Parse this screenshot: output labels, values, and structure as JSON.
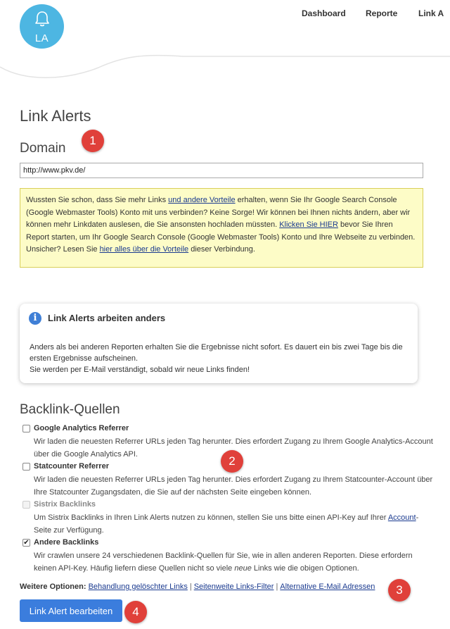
{
  "logo": {
    "text": "LA"
  },
  "nav": {
    "items": [
      "Dashboard",
      "Reporte",
      "Link A"
    ]
  },
  "page": {
    "title": "Link Alerts"
  },
  "domain": {
    "heading": "Domain",
    "value": "http://www.pkv.de/"
  },
  "hint": {
    "p1": "Wussten Sie schon, dass Sie mehr Links ",
    "link1": "und andere Vorteile",
    "p2": " erhalten, wenn Sie Ihr Google Search Console (Google Webmaster Tools) Konto mit uns verbinden? Keine Sorge! Wir können bei Ihnen nichts ändern, aber wir können mehr Linkdaten auslesen, die Sie ansonsten hochladen müssten. ",
    "link2": "Klicken Sie HIER",
    "p3": " bevor Sie Ihren Report starten, um Ihr Google Search Console (Google Webmaster Tools) Konto und Ihre Webseite zu verbinden. Unsicher? Lesen Sie ",
    "link3": "hier alles über die Vorteile",
    "p4": " dieser Verbindung."
  },
  "info": {
    "title": "Link Alerts arbeiten anders",
    "line1": "Anders als bei anderen Reporten erhalten Sie die Ergebnisse nicht sofort. Es dauert ein bis zwei Tage bis die ersten Ergebnisse aufscheinen.",
    "line2": "Sie werden per E-Mail verständigt, sobald wir neue Links finden!"
  },
  "sources": {
    "heading": "Backlink-Quellen",
    "items": [
      {
        "title": "Google Analytics Referrer",
        "checked": false,
        "disabled": false,
        "desc": "Wir laden die neuesten Referrer URLs jeden Tag herunter. Dies erfordert Zugang zu Ihrem Google Analytics-Account über die Google Analytics API."
      },
      {
        "title": "Statcounter Referrer",
        "checked": false,
        "disabled": false,
        "desc": "Wir laden die neuesten Referrer URLs jeden Tag herunter. Dies erfordert Zugang zu Ihrem Statcounter-Account über Ihre Statcounter Zugangsdaten, die Sie auf der nächsten Seite eingeben können."
      },
      {
        "title": "Sistrix Backlinks",
        "checked": false,
        "disabled": true,
        "desc_a": "Um Sistrix Backlinks in Ihren Link Alerts nutzen zu können, stellen Sie uns bitte einen API-Key auf Ihrer ",
        "desc_link": "Account",
        "desc_b": "-Seite zur Verfügung."
      },
      {
        "title": "Andere Backlinks",
        "checked": true,
        "disabled": false,
        "desc_a": "Wir crawlen unsere 24 verschiedenen Backlink-Quellen für Sie, wie in allen anderen Reporten. Diese erfordern keinen API-Key. Häufig liefern diese Quellen nicht so viele ",
        "desc_em": "neue",
        "desc_b": " Links wie die obigen Optionen."
      }
    ]
  },
  "more": {
    "label": "Weitere Optionen:",
    "links": [
      "Behandlung gelöschter Links",
      "Seitenweite Links-Filter",
      "Alternative E-Mail Adressen"
    ],
    "separator": "|"
  },
  "submit": {
    "label": "Link Alert bearbeiten"
  },
  "markers": [
    "1",
    "2",
    "3",
    "4"
  ],
  "colors": {
    "logo": "#4db6e2",
    "primary": "#3b7ddd",
    "marker": "#e0403a",
    "hint_bg": "#fdfcc7",
    "link": "#1a3a8f"
  },
  "icons": {
    "logo": "bell-icon",
    "info": "info-icon"
  }
}
